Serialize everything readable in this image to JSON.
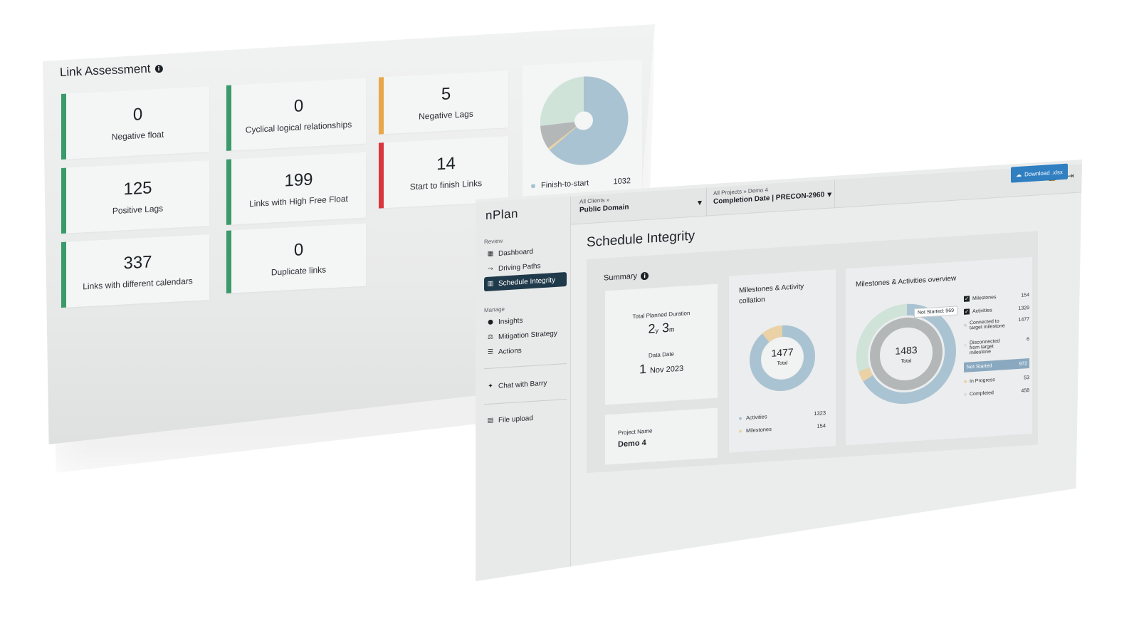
{
  "link_assessment": {
    "title": "Link Assessment",
    "metrics": [
      {
        "value": "0",
        "label": "Negative float",
        "color": "#3a9a6a"
      },
      {
        "value": "0",
        "label": "Cyclical logical relationships",
        "color": "#3a9a6a"
      },
      {
        "value": "5",
        "label": "Negative Lags",
        "color": "#e8a84a"
      },
      {
        "value": "125",
        "label": "Positive Lags",
        "color": "#3a9a6a"
      },
      {
        "value": "199",
        "label": "Links with High Free Float",
        "color": "#3a9a6a"
      },
      {
        "value": "14",
        "label": "Start to finish Links",
        "color": "#d9373d"
      },
      {
        "value": "337",
        "label": "Links with different calendars",
        "color": "#3a9a6a"
      },
      {
        "value": "0",
        "label": "Duplicate links",
        "color": "#3a9a6a"
      }
    ],
    "pie_legend": [
      {
        "label": "Finish-to-start",
        "value": "1032"
      }
    ]
  },
  "app": {
    "logo": "nPlan",
    "nav": {
      "review_label": "Review",
      "manage_label": "Manage",
      "dashboard": "Dashboard",
      "driving_paths": "Driving Paths",
      "schedule_integrity": "Schedule Integrity",
      "insights": "Insights",
      "mitigation_strategy": "Mitigation Strategy",
      "actions": "Actions",
      "chat": "Chat with Barry",
      "file_upload": "File upload"
    },
    "topbar": {
      "client_crumb": "All Clients »",
      "client_name": "Public Domain",
      "project_crumb": "All Projects » Demo 4",
      "project_name": "Completion Date | PRECON-2960"
    },
    "download_label": "Download .xlsx",
    "page_title": "Schedule Integrity",
    "summary": {
      "title": "Summary",
      "duration_label": "Total Planned Duration",
      "duration_years": "2",
      "duration_years_unit": "y",
      "duration_months": "3",
      "duration_months_unit": "m",
      "data_date_label": "Data Date",
      "data_date_day": "1",
      "data_date_rest": "Nov 2023",
      "project_name_label": "Project Name",
      "project_name": "Demo 4"
    },
    "collation": {
      "title_line1": "Milestones & Activity",
      "title_line2": "collation",
      "total": "1477",
      "total_label": "Total",
      "activities_label": "Activities",
      "activities_value": "1323",
      "milestones_label": "Milestones",
      "milestones_value": "154"
    },
    "overview": {
      "title": "Milestones & Activities overview",
      "total": "1483",
      "total_label": "Total",
      "tooltip": "Not Started: 969",
      "rows": [
        {
          "label": "Milestones",
          "value": "154"
        },
        {
          "label": "Activities",
          "value": "1329"
        },
        {
          "label": "Connected to target milestone",
          "value": "1477"
        },
        {
          "label": "Disconnected from target milestone",
          "value": "6"
        },
        {
          "label": "Not Started",
          "value": "972"
        },
        {
          "label": "In Progress",
          "value": "53"
        },
        {
          "label": "Completed",
          "value": "458"
        }
      ]
    },
    "colors": {
      "accent": "#2f7fc1",
      "sidebar_active": "#1f3a4a",
      "blue_slice": "#a9c3d2",
      "green_slice": "#cfe3d8",
      "grey_slice": "#b4b7b8",
      "tan_slice": "#ead2a6"
    }
  }
}
